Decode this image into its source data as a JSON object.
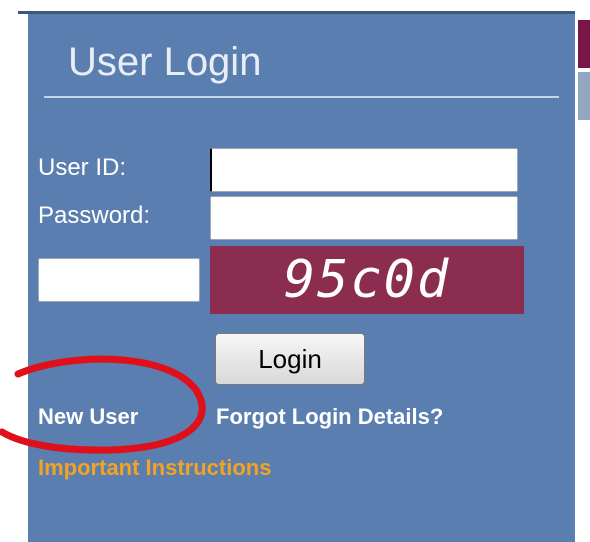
{
  "login_panel": {
    "title": "User Login",
    "userid_label": "User ID:",
    "password_label": "Password:",
    "userid_value": "",
    "password_value": "",
    "captcha_input_value": "",
    "captcha_text": "95c0d",
    "login_button": "Login",
    "new_user_link": "New User",
    "forgot_link": "Forgot Login Details?",
    "instructions_link": "Important Instructions"
  },
  "colors": {
    "panel_bg": "#5a7eb0",
    "captcha_bg": "#8b2d4e",
    "instructions_link": "#f2a321",
    "annotation_circle": "#e0101a"
  },
  "annotations": {
    "circle_target": "new-user-link"
  }
}
